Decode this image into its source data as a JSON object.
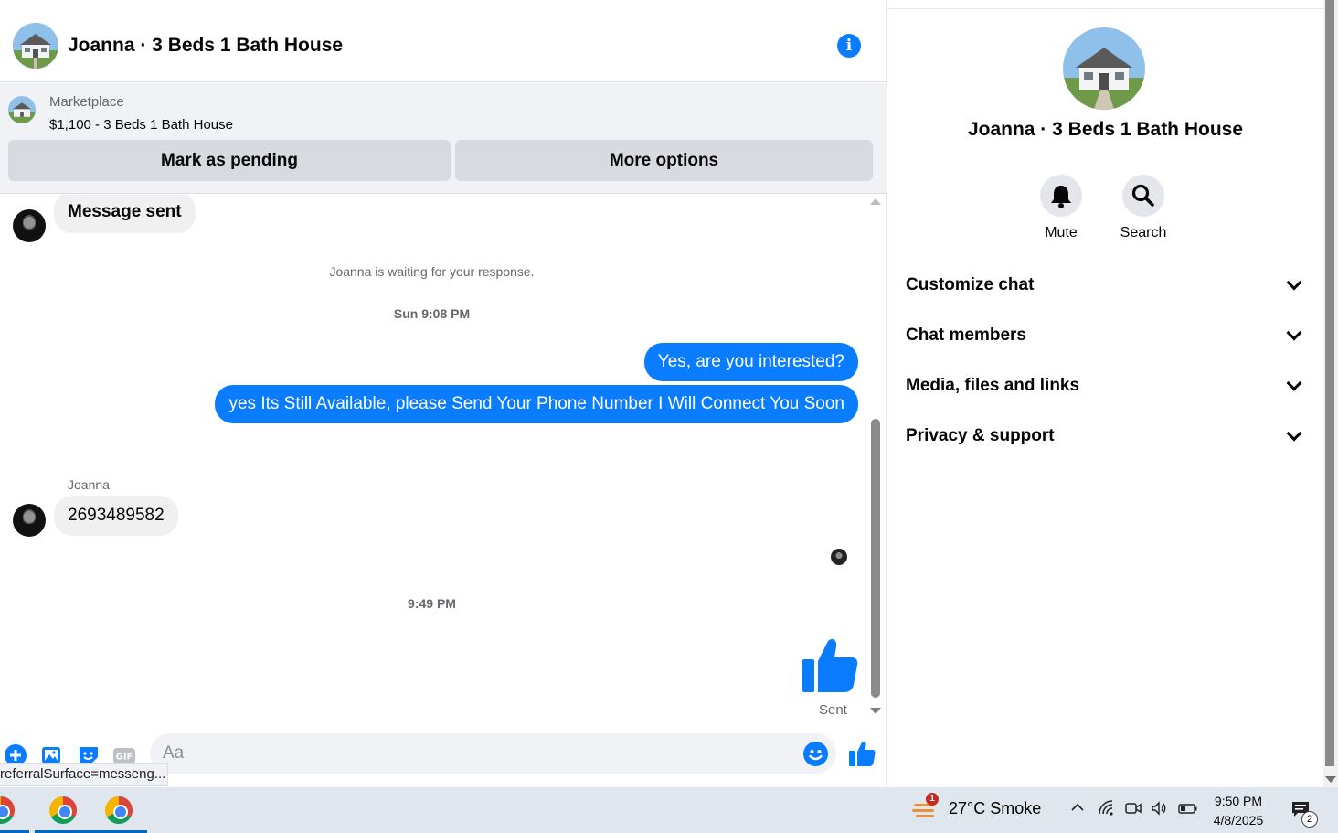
{
  "chat": {
    "title": "Joanna · 3 Beds 1 Bath House",
    "marketplace": {
      "label": "Marketplace",
      "listing": "$1,100 - 3 Beds 1 Bath House",
      "pending_button": "Mark as pending",
      "more_button": "More options"
    },
    "messages": {
      "first_incoming": "Message sent",
      "waiting_notice": "Joanna is waiting for your response.",
      "timestamp_1": "Sun 9:08 PM",
      "outgoing_1": "Yes, are you interested?",
      "outgoing_2": "yes Its Still Available, please Send Your Phone Number I Will Connect You Soon",
      "sender_name": "Joanna",
      "incoming_phone": "2693489582",
      "timestamp_2": "9:49 PM",
      "sent_status": "Sent"
    },
    "composer": {
      "placeholder": "Aa"
    },
    "status_url": "referralSurface=messeng..."
  },
  "details": {
    "title": "Joanna · 3 Beds 1 Bath House",
    "actions": {
      "mute": "Mute",
      "search": "Search"
    },
    "sections": [
      {
        "label": "Customize chat"
      },
      {
        "label": "Chat members"
      },
      {
        "label": "Media, files and links"
      },
      {
        "label": "Privacy & support"
      }
    ]
  },
  "taskbar": {
    "weather": "27°C  Smoke",
    "weather_badge": "1",
    "time": "9:50 PM",
    "date": "4/8/2025",
    "notification_count": "2"
  },
  "colors": {
    "accent": "#0a7cff",
    "bubble_in": "#f0f0f0",
    "banner_bg": "#f0f2f5"
  }
}
